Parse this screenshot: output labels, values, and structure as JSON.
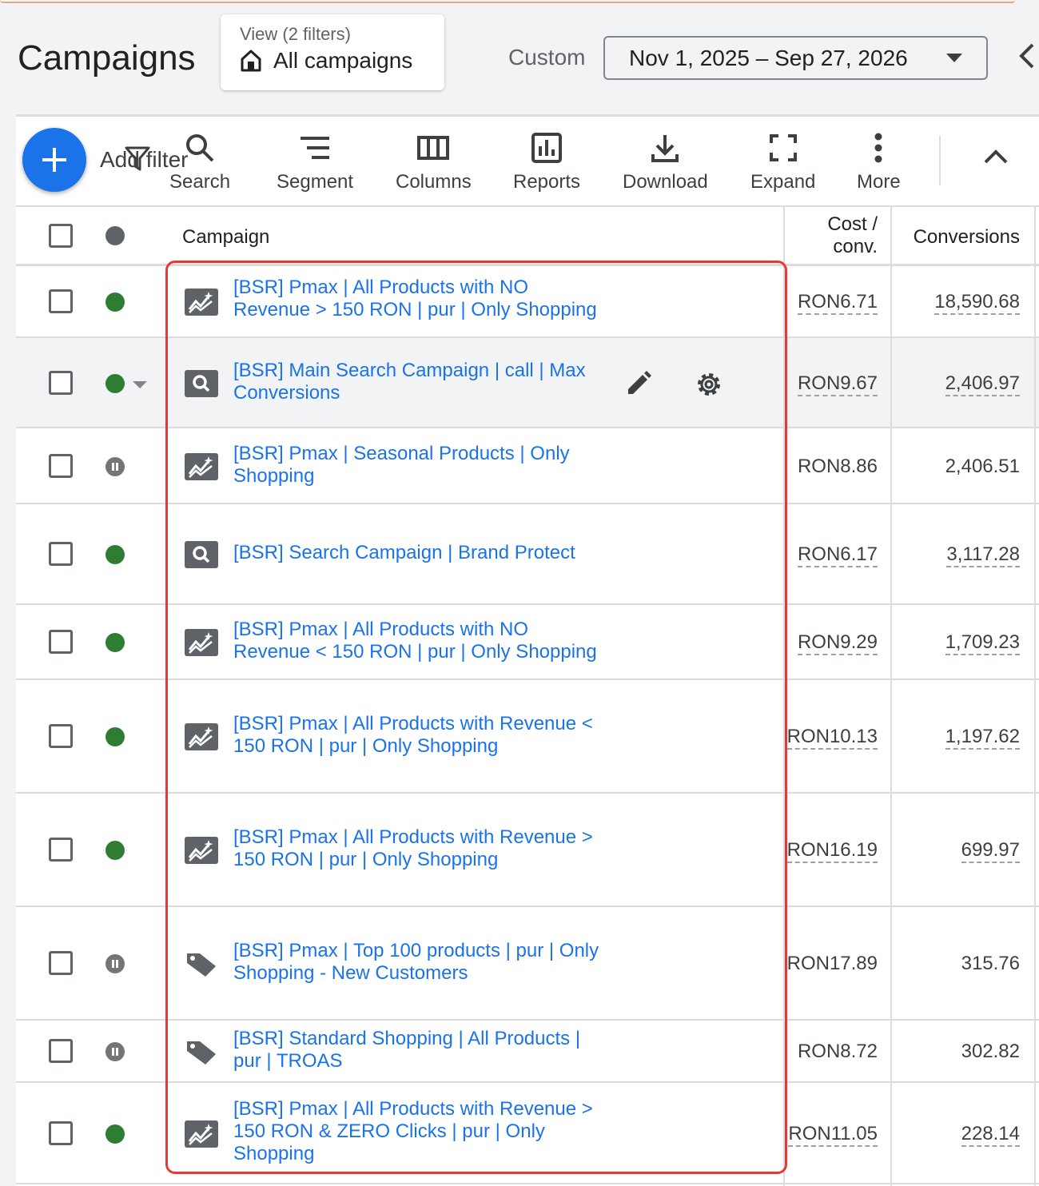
{
  "header": {
    "title": "Campaigns",
    "view_label": "View (2 filters)",
    "view_name": "All campaigns",
    "range_type": "Custom",
    "date_range": "Nov 1, 2025 – Sep 27, 2026"
  },
  "toolbar": {
    "add_filter": "Add filter",
    "search": "Search",
    "segment": "Segment",
    "columns": "Columns",
    "reports": "Reports",
    "download": "Download",
    "expand": "Expand",
    "more": "More"
  },
  "table": {
    "headers": {
      "campaign": "Campaign",
      "cost_conv_line1": "Cost /",
      "cost_conv_line2": "conv.",
      "conversions": "Conversions"
    },
    "rows": [
      {
        "name": "[BSR] Pmax | All Products with NO Revenue > 150 RON | pur | Only Shopping",
        "status": "enabled",
        "type": "pmax-icon",
        "cost_conv": "RON6.71",
        "conversions": "18,590.68"
      },
      {
        "name": "[BSR] Main Search Campaign | call | Max Conversions",
        "status": "enabled",
        "type": "search-icon",
        "cost_conv": "RON9.67",
        "conversions": "2,406.97"
      },
      {
        "name": "[BSR] Pmax | Seasonal Products | Only Shopping",
        "status": "paused",
        "type": "pmax-icon",
        "cost_conv": "RON8.86",
        "conversions": "2,406.51"
      },
      {
        "name": "[BSR] Search Campaign | Brand Protect",
        "status": "enabled",
        "type": "search-icon",
        "cost_conv": "RON6.17",
        "conversions": "3,117.28"
      },
      {
        "name": "[BSR] Pmax | All Products with NO Revenue < 150 RON | pur | Only Shopping",
        "status": "enabled",
        "type": "pmax-icon",
        "cost_conv": "RON9.29",
        "conversions": "1,709.23"
      },
      {
        "name": "[BSR] Pmax | All Products with Revenue < 150 RON | pur | Only Shopping",
        "status": "enabled",
        "type": "pmax-icon",
        "cost_conv": "RON10.13",
        "conversions": "1,197.62"
      },
      {
        "name": "[BSR] Pmax | All Products with Revenue > 150 RON | pur | Only Shopping",
        "status": "enabled",
        "type": "pmax-icon",
        "cost_conv": "RON16.19",
        "conversions": "699.97"
      },
      {
        "name": "[BSR] Pmax | Top 100 products | pur | Only Shopping - New Customers",
        "status": "paused",
        "type": "shopping-tag-icon",
        "cost_conv": "RON17.89",
        "conversions": "315.76"
      },
      {
        "name": "[BSR] Standard Shopping | All Products | pur | TROAS",
        "status": "paused",
        "type": "shopping-tag-icon",
        "cost_conv": "RON8.72",
        "conversions": "302.82"
      },
      {
        "name": "[BSR] Pmax | All Products with Revenue > 150 RON & ZERO Clicks | pur | Only Shopping",
        "status": "enabled",
        "type": "pmax-icon",
        "cost_conv": "RON11.05",
        "conversions": "228.14"
      }
    ]
  },
  "colors": {
    "link": "#1a73e8",
    "enabled": "#2e7d32",
    "paused": "#757575",
    "highlight": "#e53935",
    "fab": "#1a73e8"
  }
}
